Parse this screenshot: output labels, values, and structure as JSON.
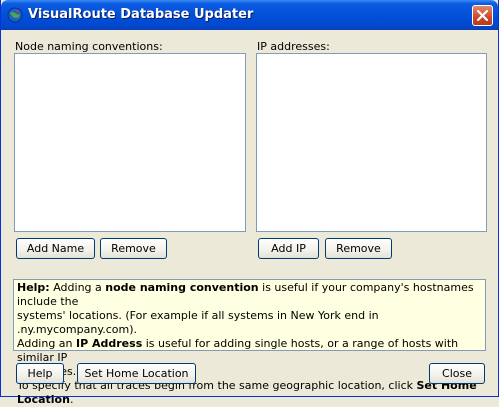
{
  "window": {
    "title": "VisualRoute Database Updater",
    "colors": {
      "titlebar": "#0250d8",
      "close": "#c94a2a",
      "help_bg": "#ffffe1"
    }
  },
  "left_panel": {
    "label": "Node naming conventions:",
    "add_label": "Add Name",
    "remove_label": "Remove"
  },
  "right_panel": {
    "label": "IP addresses:",
    "add_label": "Add IP",
    "remove_label": "Remove"
  },
  "help": {
    "l1_a": "Help:",
    "l1_b": " Adding a ",
    "l1_c": "node naming convention",
    "l1_d": " is useful if your company's hostnames include the",
    "l2": "systems' locations. (For example if all systems in New York end in .ny.mycompany.com).",
    "l3_a": "Adding an ",
    "l3_b": "IP Address",
    "l3_c": " is useful for adding single hosts, or a range of hosts with similar IP",
    "l4": "addresses.",
    "l5_a": "To specify that all traces begin from the same geographic location, click ",
    "l5_b": "Set Home Location",
    "l5_c": "."
  },
  "footer": {
    "help_label": "Help",
    "set_home_label": "Set Home Location",
    "close_label": "Close"
  }
}
